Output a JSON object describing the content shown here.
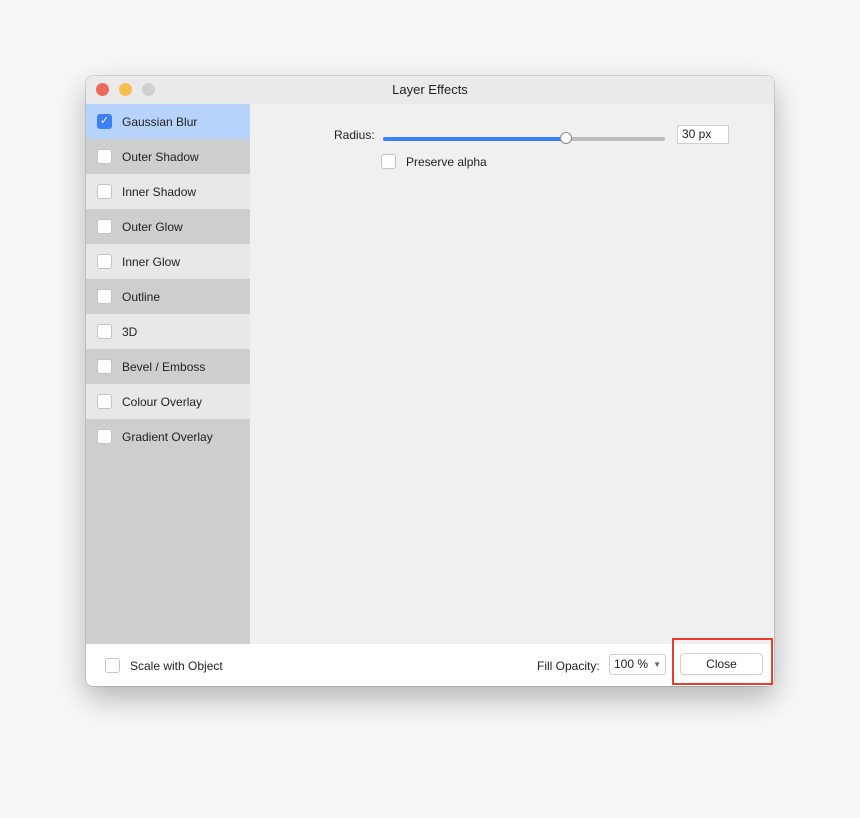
{
  "window": {
    "title": "Layer Effects"
  },
  "sidebar": {
    "items": [
      {
        "label": "Gaussian Blur",
        "checked": true,
        "selected": true
      },
      {
        "label": "Outer Shadow",
        "checked": false
      },
      {
        "label": "Inner Shadow",
        "checked": false
      },
      {
        "label": "Outer Glow",
        "checked": false
      },
      {
        "label": "Inner Glow",
        "checked": false
      },
      {
        "label": "Outline",
        "checked": false
      },
      {
        "label": "3D",
        "checked": false
      },
      {
        "label": "Bevel / Emboss",
        "checked": false
      },
      {
        "label": "Colour Overlay",
        "checked": false
      },
      {
        "label": "Gradient Overlay",
        "checked": false
      }
    ]
  },
  "content": {
    "radius_label": "Radius:",
    "radius_slider_fraction": 0.65,
    "radius_value": "30 px",
    "preserve_alpha_label": "Preserve alpha",
    "preserve_alpha_checked": false
  },
  "footer": {
    "scale_label": "Scale with Object",
    "scale_checked": false,
    "fill_opacity_label": "Fill Opacity:",
    "fill_opacity_value": "100 %",
    "close_label": "Close"
  },
  "colors": {
    "accent": "#3c82f6",
    "selected_row": "#b7d3fb",
    "highlight": "#e8402e"
  }
}
